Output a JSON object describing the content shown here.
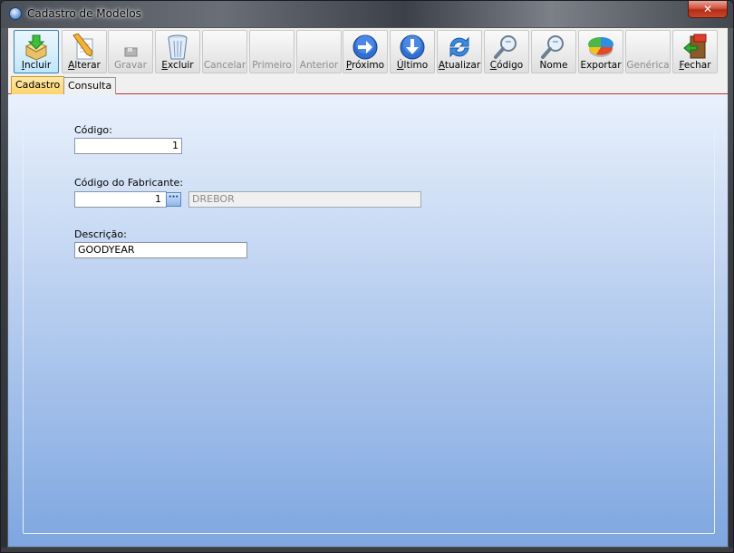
{
  "window": {
    "title": "Cadastro de Modelos",
    "close_glyph": "✕"
  },
  "toolbar": {
    "buttons": [
      {
        "label": "Incluir",
        "hotkey": "I",
        "rest": "ncluir",
        "icon": "add-folder-icon",
        "enabled": true,
        "active": true
      },
      {
        "label": "Alterar",
        "hotkey": "A",
        "rest": "lterar",
        "icon": "pencil-edit-icon",
        "enabled": true
      },
      {
        "label": "Gravar",
        "icon": "save-icon",
        "enabled": false
      },
      {
        "label": "Excluir",
        "hotkey": "E",
        "rest": "xcluir",
        "icon": "trash-icon",
        "enabled": true
      },
      {
        "label": "Cancelar",
        "icon": "cancel-icon",
        "enabled": false
      },
      {
        "label": "Primeiro",
        "icon": "first-record-icon",
        "enabled": false
      },
      {
        "label": "Anterior",
        "icon": "previous-record-icon",
        "enabled": false
      },
      {
        "label": "Próximo",
        "hotkey": "P",
        "rest": "róximo",
        "icon": "next-arrow-icon",
        "enabled": true
      },
      {
        "label": "Último",
        "hotkey": "Ú",
        "rest": "ltimo",
        "icon": "last-arrow-icon",
        "enabled": true
      },
      {
        "label": "Atualizar",
        "hotkey": "A",
        "rest": "tualizar",
        "icon": "refresh-icon",
        "enabled": true
      },
      {
        "label": "Código",
        "hotkey": "C",
        "rest": "ódigo",
        "icon": "search-code-icon",
        "enabled": true
      },
      {
        "label": "Nome",
        "icon": "search-name-icon",
        "enabled": true
      },
      {
        "label": "Exportar",
        "icon": "pie-chart-export-icon",
        "enabled": true
      },
      {
        "label": "Genérica",
        "icon": "generic-icon",
        "enabled": false
      },
      {
        "label": "Fechar",
        "hotkey": "F",
        "rest": "echar",
        "icon": "exit-door-icon",
        "enabled": true
      }
    ]
  },
  "tabs": [
    {
      "label": "Cadastro",
      "active": true
    },
    {
      "label": "Consulta",
      "active": false
    }
  ],
  "form": {
    "codigo_label": "Código:",
    "codigo_value": "1",
    "fabricante_label": "Código do Fabricante:",
    "fabricante_value": "1",
    "fabricante_lookup_glyph": "···",
    "fabricante_name": "DREBOR",
    "descricao_label": "Descrição:",
    "descricao_value": "GOODYEAR"
  }
}
